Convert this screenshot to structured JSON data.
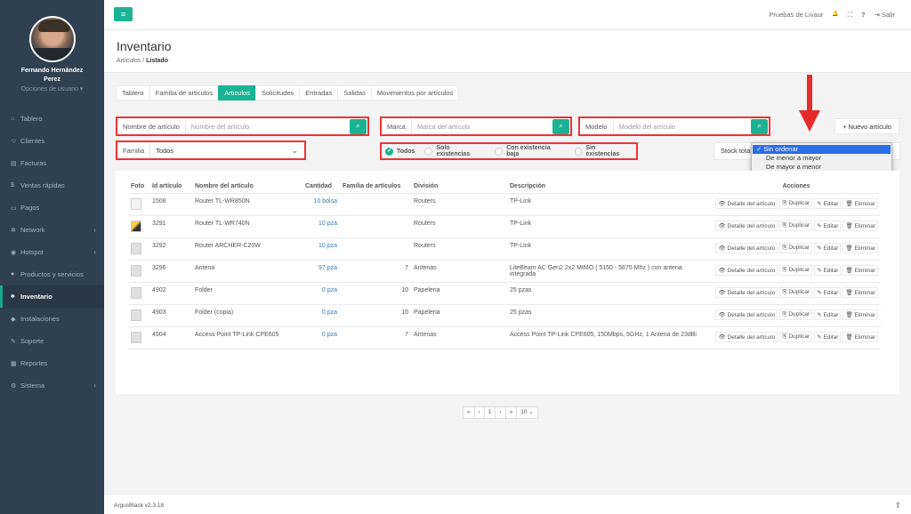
{
  "user": {
    "name_line1": "Fernando Hernández",
    "name_line2": "Perez",
    "options": "Opciones de usuario ▾"
  },
  "nav": [
    {
      "icon": "⌂",
      "label": "Tablero"
    },
    {
      "icon": "☺",
      "label": "Clientes"
    },
    {
      "icon": "▤",
      "label": "Facturas"
    },
    {
      "icon": "$",
      "label": "Ventas rápidas"
    },
    {
      "icon": "▭",
      "label": "Pagos"
    },
    {
      "icon": "✲",
      "label": "Network"
    },
    {
      "icon": "◉",
      "label": "Hotspot"
    },
    {
      "icon": "●",
      "label": "Productos y servicios"
    },
    {
      "icon": "♣",
      "label": "Inventario"
    },
    {
      "icon": "◆",
      "label": "Instalaciones"
    },
    {
      "icon": "✎",
      "label": "Soporte"
    },
    {
      "icon": "▦",
      "label": "Reportes"
    },
    {
      "icon": "⚙",
      "label": "Sistema"
    }
  ],
  "topbar": {
    "menu": "≡",
    "company": "Pruebas de Livaur",
    "bell": "🔔",
    "fullscreen": "⛶",
    "help": "?",
    "logout": "⇥ Salir"
  },
  "heading": {
    "title": "Inventario",
    "crumb1": "Artículos",
    "sep": "/",
    "crumb2": "Listado"
  },
  "tabs": [
    "Tablero",
    "Familia de articulos",
    "Articulos",
    "Solicitudes",
    "Entradas",
    "Salidas",
    "Movimientos por artículos"
  ],
  "filters": {
    "name_label": "Nombre de artículo",
    "name_placeholder": "Nombre del artículo",
    "brand_label": "Marca",
    "brand_placeholder": "Marca del artículo",
    "model_label": "Modelo",
    "model_placeholder": "Modelo del artículo",
    "family_label": "Familia",
    "family_value": "Todos",
    "search_icon": "🔍"
  },
  "new_button": "+ Nuevo artículo",
  "radios": [
    "Todos",
    "Solo existencias",
    "Con existencia baja",
    "Sin existencias"
  ],
  "stock_label": "Stock total",
  "sort_options": [
    "Sin ordenar",
    "De menor a mayor",
    "De mayor a menor"
  ],
  "columns": [
    "Foto",
    "Id artículo",
    "Nombre del artículo",
    "Cantidad",
    "Familia de artículos",
    "División",
    "Descripción",
    "Acciones"
  ],
  "actions": [
    "👁 Detalle del artículo",
    "⎘ Duplicar",
    "✎ Editar",
    "🗑 Eliminar"
  ],
  "rows": [
    {
      "id": "1508",
      "name": "Router TL-WR850N",
      "qty": "10 bolsa",
      "fam": "",
      "div": "Routers",
      "desc": "TP-Link",
      "desc2": ""
    },
    {
      "id": "3291",
      "name": "Router TL-WR740N",
      "qty": "10 pza",
      "fam": "",
      "div": "Routers",
      "desc": "TP-Link",
      "desc2": ""
    },
    {
      "id": "3292",
      "name": "Router ARCHER-C20W",
      "qty": "10 pza",
      "fam": "",
      "div": "Routers",
      "desc": "TP-Link",
      "desc2": ""
    },
    {
      "id": "3296",
      "name": "Antena",
      "qty": "97 pza",
      "fam": "7",
      "div": "Antenas",
      "desc": "LiteBeam AC Gen2 2x2 MIMO ( 5150 - 5875 Mhz ) con antena",
      "desc2": "integrada"
    },
    {
      "id": "4902",
      "name": "Folder",
      "qty": "0 pza",
      "fam": "10",
      "div": "Papeleria",
      "desc": "25 pzas",
      "desc2": ""
    },
    {
      "id": "4903",
      "name": "Folder (copia)",
      "qty": "0 pza",
      "fam": "10",
      "div": "Papeleria",
      "desc": "25 pzas",
      "desc2": ""
    },
    {
      "id": "4904",
      "name": "Access Point TP-Link CPE605",
      "qty": "0 pza",
      "fam": "7",
      "div": "Antenas",
      "desc": "Access Point TP-Link CPE605, 150Mbps, 5GHz, 1 Antena de 23dBi",
      "desc2": ""
    }
  ],
  "pager": [
    "«",
    "‹",
    "1",
    "›",
    "»",
    "10 ⌄"
  ],
  "footer": "ArgusBlack v2.3.18",
  "colors": {
    "accent": "#1ab394",
    "sidebar": "#2f4050",
    "highlight": "#e33333",
    "link": "#337ab7"
  }
}
